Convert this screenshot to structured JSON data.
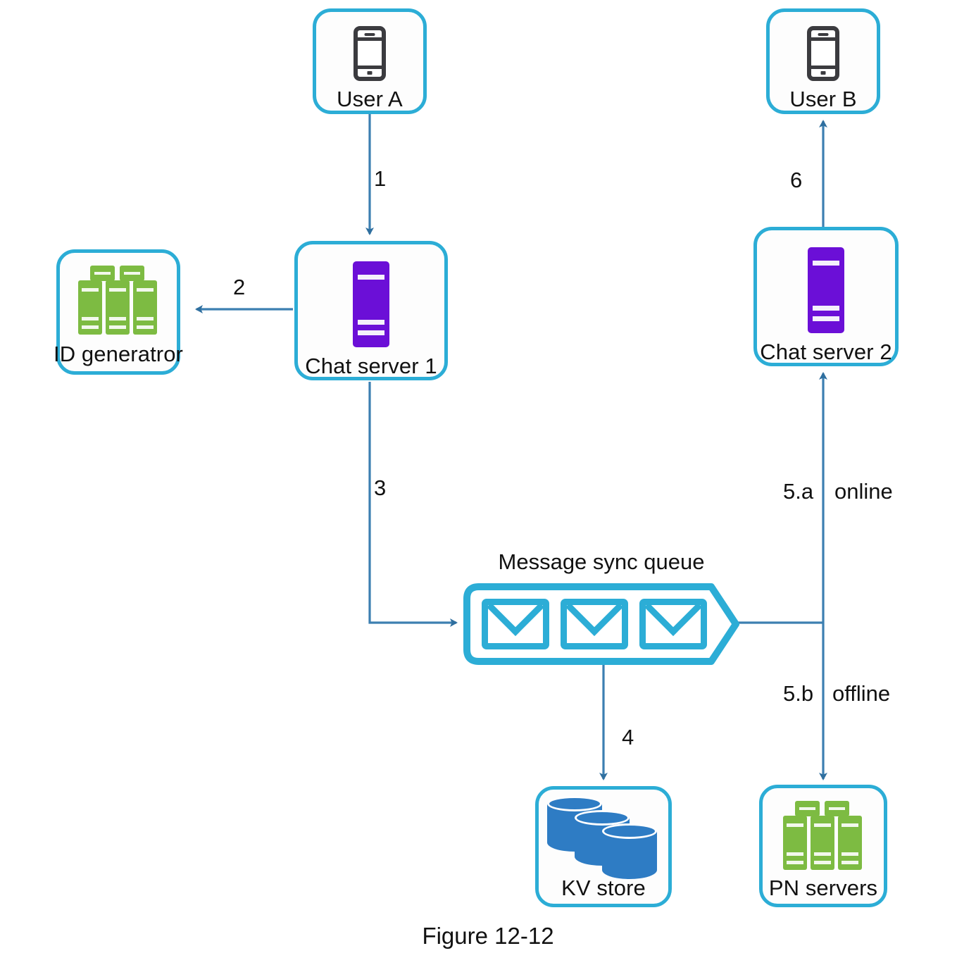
{
  "figure": {
    "caption": "Figure 12-12"
  },
  "nodes": [
    {
      "id": "user-a",
      "label": "User A",
      "icon": "phone-icon"
    },
    {
      "id": "user-b",
      "label": "User B",
      "icon": "phone-icon"
    },
    {
      "id": "id-generator",
      "label": "ID generatror",
      "icon": "server-rack-icon"
    },
    {
      "id": "chat-server-1",
      "label": "Chat server 1",
      "icon": "server-icon"
    },
    {
      "id": "chat-server-2",
      "label": "Chat server 2",
      "icon": "server-icon"
    },
    {
      "id": "kv-store",
      "label": "KV store",
      "icon": "database-cylinders-icon"
    },
    {
      "id": "pn-servers",
      "label": "PN servers",
      "icon": "server-rack-icon"
    }
  ],
  "queue": {
    "title": "Message sync queue",
    "message_count": 3,
    "icon": "envelope-icon"
  },
  "edges": [
    {
      "id": "e1",
      "from": "user-a",
      "to": "chat-server-1",
      "label": "1"
    },
    {
      "id": "e2",
      "from": "chat-server-1",
      "to": "id-generator",
      "label": "2"
    },
    {
      "id": "e3",
      "from": "chat-server-1",
      "to": "queue",
      "label": "3"
    },
    {
      "id": "e4",
      "from": "queue",
      "to": "kv-store",
      "label": "4"
    },
    {
      "id": "e5a",
      "from": "queue",
      "to": "chat-server-2",
      "label": "5.a",
      "note": "online"
    },
    {
      "id": "e5b",
      "from": "queue",
      "to": "pn-servers",
      "label": "5.b",
      "note": "offline"
    },
    {
      "id": "e6",
      "from": "chat-server-2",
      "to": "user-b",
      "label": "6"
    }
  ],
  "colors": {
    "node_border": "#2CADD6",
    "queue": "#2CADD6",
    "arrow": "#2F6F9F",
    "server_purple": "#6B0FD7",
    "rack_green": "#7DBB42",
    "cylinder_blue": "#2E7CC4",
    "phone_dark": "#3B3B3F",
    "background": "#FFFFFF"
  }
}
